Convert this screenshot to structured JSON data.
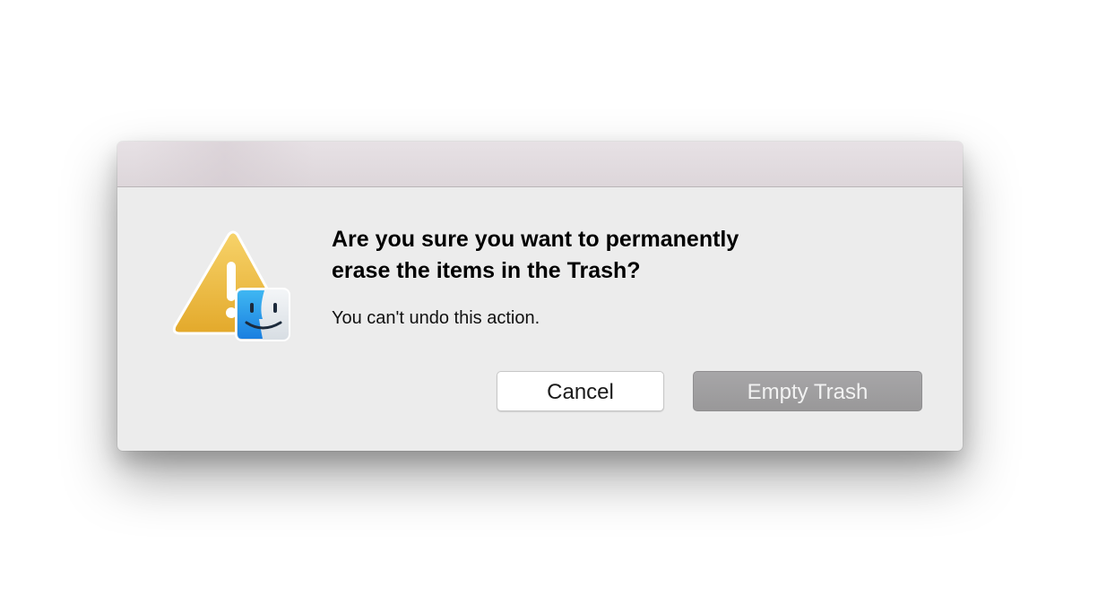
{
  "dialog": {
    "headline_line1": "Are you sure you want to permanently",
    "headline_line2": "erase the items in the Trash?",
    "message": "You can't undo this action.",
    "icon": "warning-finder-icon",
    "buttons": {
      "cancel_label": "Cancel",
      "confirm_label": "Empty Trash"
    }
  },
  "colors": {
    "dialog_background": "#ececec",
    "warning_triangle": "#eebb3a",
    "confirm_button": "#9f9ea0",
    "cancel_button": "#ffffff"
  }
}
